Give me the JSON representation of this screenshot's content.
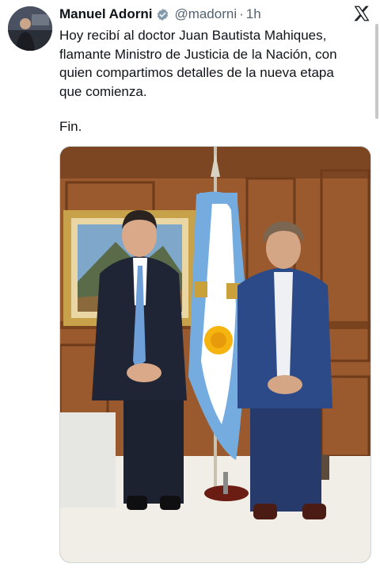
{
  "author": {
    "display_name": "Manuel Adorni",
    "handle": "@madorni",
    "separator": "·",
    "time_ago": "1h",
    "verified": true,
    "verified_color": "#829aab"
  },
  "tweet": {
    "text": "Hoy recibí al doctor Juan Bautista Mahiques,\nflamante Ministro de Justicia de la Nación, con\nquien compartimos detalles de la nueva etapa\nque comienza.",
    "closing": "Fin."
  },
  "media": {
    "subjects": [
      "man-left-dark-suit",
      "argentina-flag",
      "man-right-blue-suit"
    ],
    "flag_colors": {
      "blue": "#74acdf",
      "white": "#ffffff",
      "sun": "#f6b40e"
    }
  },
  "icons": {
    "platform": "x-logo",
    "badge": "verified-badge"
  }
}
